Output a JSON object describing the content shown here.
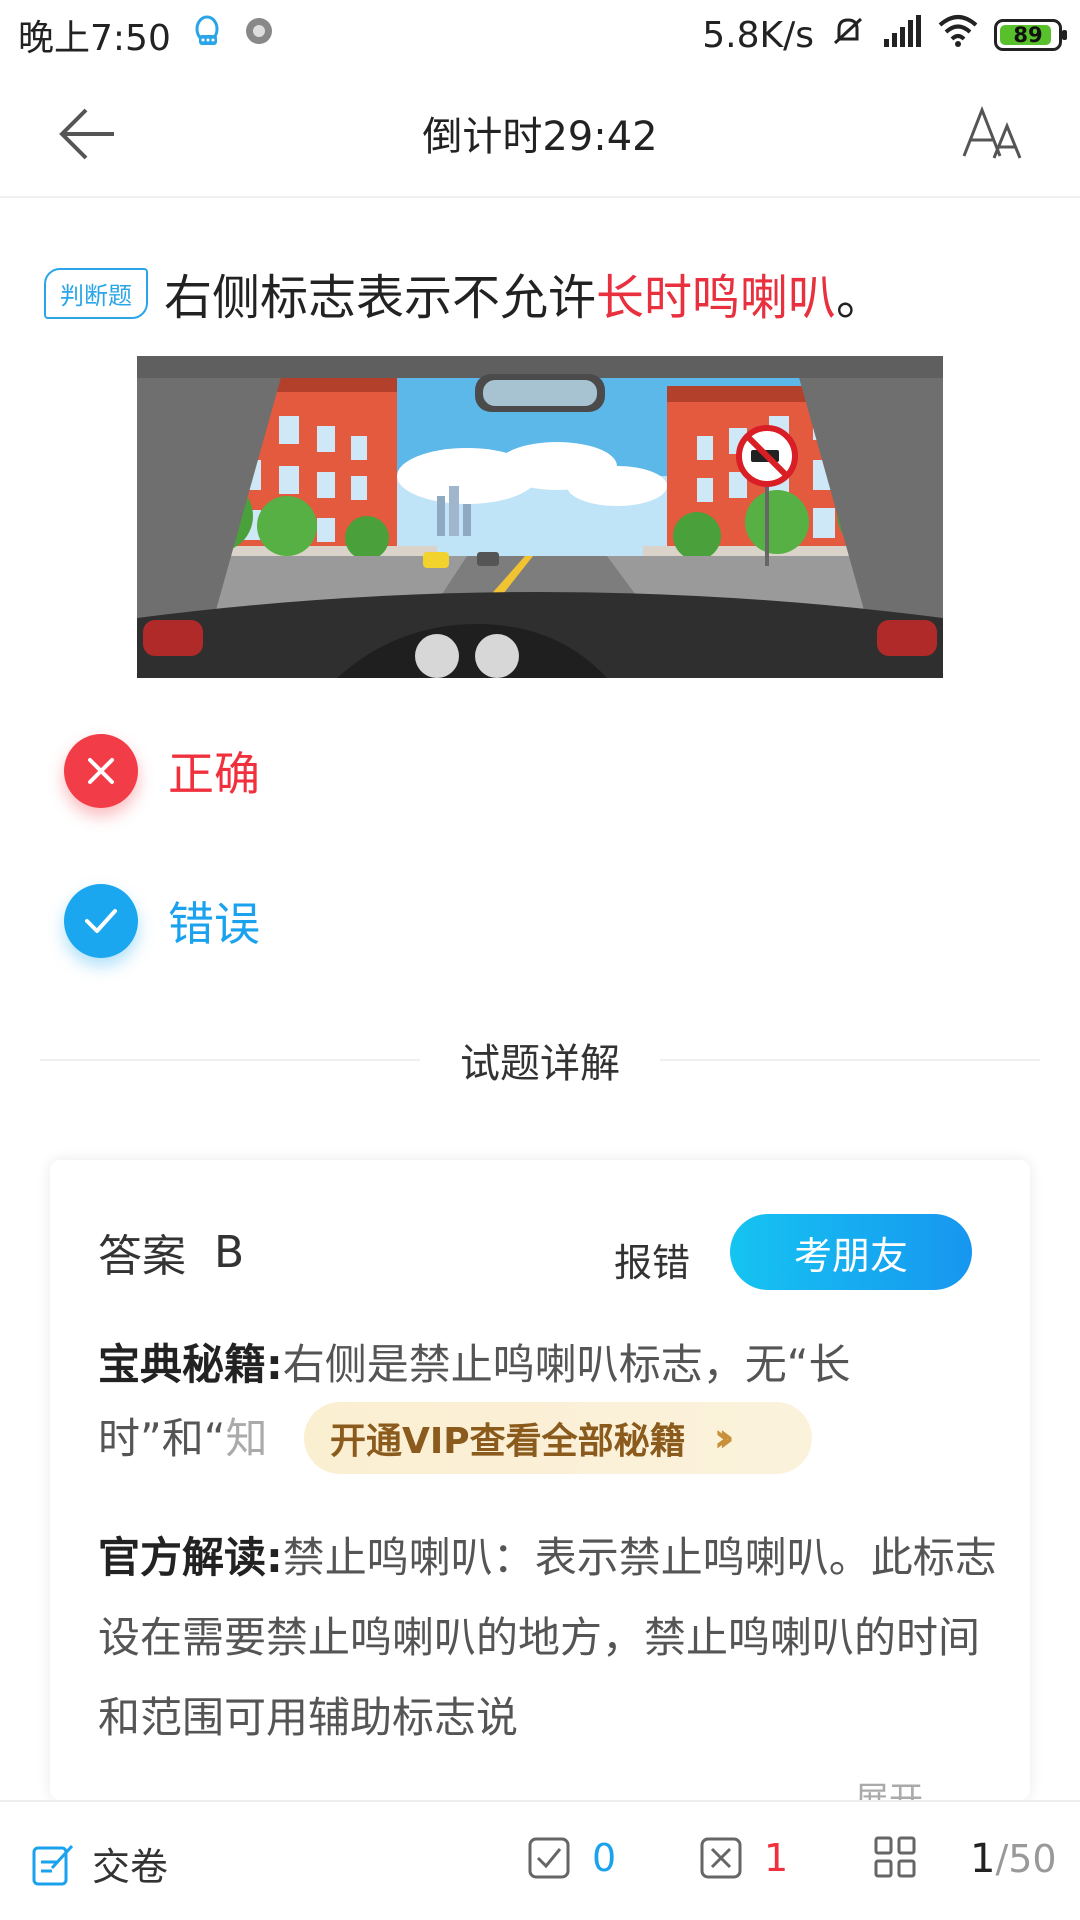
{
  "status_bar": {
    "time": "晚上7:50",
    "speed": "5.8K/s",
    "battery": "89"
  },
  "header": {
    "title": "倒计时29:42"
  },
  "question": {
    "type_tag": "判断题",
    "text_before": "右侧标志表示不允许",
    "text_highlight": "长时鸣喇叭",
    "text_after": "。"
  },
  "options": [
    {
      "label": "正确",
      "state": "wrong"
    },
    {
      "label": "错误",
      "state": "correct"
    }
  ],
  "explain": {
    "section_title": "试题详解",
    "answer_label": "答案",
    "answer_value": "B",
    "report_label": "报错",
    "kpy_button": "考朋友",
    "secret_label": "宝典秘籍:",
    "secret_text": "右侧是禁止鸣喇叭标志，无“长时”和“",
    "secret_fade": "知",
    "vip_button": "开通VIP查看全部秘籍",
    "official_label": "官方解读:",
    "official_text": "禁止鸣喇叭：表示禁止鸣喇叭。此标志设在需要禁止鸣喇叭的地方，禁止鸣喇叭的时间和范围可用辅助标志说",
    "expand_label": "展开"
  },
  "bottom_bar": {
    "submit_label": "交卷",
    "correct_count": "0",
    "wrong_count": "1",
    "page_current": "1",
    "page_total": "/50"
  }
}
